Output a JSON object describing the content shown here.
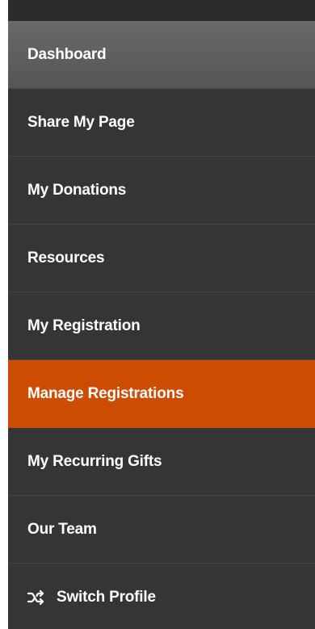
{
  "nav": {
    "items": [
      {
        "label": "Dashboard",
        "state": "hover"
      },
      {
        "label": "Share My Page"
      },
      {
        "label": "My Donations"
      },
      {
        "label": "Resources"
      },
      {
        "label": "My Registration"
      },
      {
        "label": "Manage Registrations",
        "state": "current"
      },
      {
        "label": "My Recurring Gifts"
      },
      {
        "label": "Our Team"
      },
      {
        "label": "Switch Profile",
        "icon": "shuffle-icon"
      }
    ]
  },
  "colors": {
    "panel_bg": "#353535",
    "highlight_bg": "#5f5f5f",
    "current_bg": "#cc4c02",
    "text": "#ffffff"
  }
}
